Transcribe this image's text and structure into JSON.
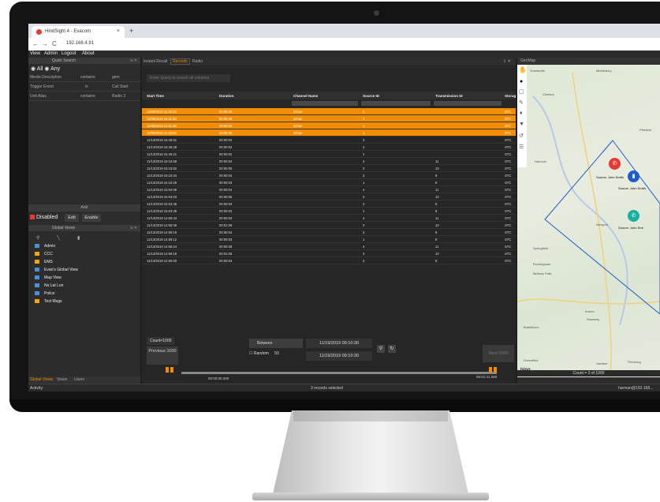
{
  "browser": {
    "tab_title": "HindSight 4 - Evacom",
    "tab_close": "×",
    "new_tab": "+",
    "nav_back": "←",
    "nav_forward": "→",
    "nav_reload": "C",
    "url": "192.168.4.91"
  },
  "menu": [
    "View",
    "Admin",
    "Logout",
    "About"
  ],
  "quick_search": {
    "title": "Quick Search",
    "radio_all": "All",
    "radio_any": "Any",
    "filters": [
      {
        "field": "Media Description",
        "op": "contains",
        "value": "gem"
      },
      {
        "field": "Trigger Event",
        "op": "is",
        "value": "Call Start"
      },
      {
        "field": "Unit Alias",
        "op": "contains",
        "value": "Radio 2"
      }
    ],
    "add_label": "Add",
    "disabled_label": "Disabled",
    "edit_label": "Edit",
    "enable_label": "Enable"
  },
  "global_views": {
    "title": "Global Views",
    "items": [
      {
        "label": "Admin",
        "color": "#4a90d9"
      },
      {
        "label": "CCC",
        "color": "#f2a900"
      },
      {
        "label": "EMS",
        "color": "#f2a900"
      },
      {
        "label": "Evan's Global View",
        "color": "#4a90d9"
      },
      {
        "label": "Map View",
        "color": "#4a90d9"
      },
      {
        "label": "No Lat Lon",
        "color": "#4a90d9"
      },
      {
        "label": "Police",
        "color": "#4a90d9"
      },
      {
        "label": "Text Msgs",
        "color": "#f2a900"
      }
    ],
    "bottom_tabs": [
      "Global Views",
      "Views",
      "Users"
    ]
  },
  "center": {
    "tabs": [
      "Instant Recall",
      "Records",
      "Radio"
    ],
    "query_placeholder": "Enter Query to search all columns",
    "columns": [
      "Start Time",
      "Duration",
      "Channel Name",
      "Source ID",
      "Transmission ID",
      "Storag"
    ],
    "rows": [
      {
        "start": "11/05/2019 11:42:24",
        "dur": "00:00:48",
        "chan": "4chan",
        "src": "2",
        "tx": "",
        "sto": "STC",
        "sel": true
      },
      {
        "start": "11/05/2019 11:41:30",
        "dur": "00:00:48",
        "chan": "4chan",
        "src": "1",
        "tx": "",
        "sto": "STC",
        "sel": true
      },
      {
        "start": "11/05/2019 11:41:30",
        "dur": "00:00:48",
        "chan": "4chan",
        "src": "1",
        "tx": "",
        "sto": "STC",
        "sel": true
      },
      {
        "start": "11/05/2019 11:43:04",
        "dur": "00:00:48",
        "chan": "4chan",
        "src": "1",
        "tx": "",
        "sto": "STC",
        "sel": true
      },
      {
        "start": "11/13/2019 15:45:51",
        "dur": "00:00:02",
        "chan": "",
        "src": "3",
        "tx": "",
        "sto": "STC",
        "sel": false
      },
      {
        "start": "11/13/2019 15:45:28",
        "dur": "00:00:02",
        "chan": "",
        "src": "2",
        "tx": "",
        "sto": "STC",
        "sel": false
      },
      {
        "start": "11/13/2019 15:45:21",
        "dur": "00:00:02",
        "chan": "",
        "src": "1",
        "tx": "",
        "sto": "STC",
        "sel": false
      },
      {
        "start": "11/13/2019 15:15:58",
        "dur": "00:00:04",
        "chan": "",
        "src": "4",
        "tx": "11",
        "sto": "STC",
        "sel": false
      },
      {
        "start": "11/13/2019 15:15:52",
        "dur": "00:00:05",
        "chan": "",
        "src": "3",
        "tx": "10",
        "sto": "STC",
        "sel": false
      },
      {
        "start": "11/13/2019 15:15:34",
        "dur": "00:00:04",
        "chan": "",
        "src": "2",
        "tx": "9",
        "sto": "STC",
        "sel": false
      },
      {
        "start": "11/13/2019 15:15:28",
        "dur": "00:00:03",
        "chan": "",
        "src": "1",
        "tx": "8",
        "sto": "STC",
        "sel": false
      },
      {
        "start": "11/13/2019 15:04:09",
        "dur": "00:00:04",
        "chan": "",
        "src": "4",
        "tx": "11",
        "sto": "STC",
        "sel": false
      },
      {
        "start": "11/13/2019 15:04:03",
        "dur": "00:00:05",
        "chan": "",
        "src": "3",
        "tx": "10",
        "sto": "STC",
        "sel": false
      },
      {
        "start": "11/13/2019 15:03:45",
        "dur": "00:00:04",
        "chan": "",
        "src": "2",
        "tx": "9",
        "sto": "STC",
        "sel": false
      },
      {
        "start": "11/13/2019 15:03:39",
        "dur": "00:00:03",
        "chan": "",
        "src": "1",
        "tx": "8",
        "sto": "STC",
        "sel": false
      },
      {
        "start": "11/13/2019 14:59:43",
        "dur": "00:00:03",
        "chan": "",
        "src": "4",
        "tx": "11",
        "sto": "STC",
        "sel": false
      },
      {
        "start": "11/13/2019 14:59:36",
        "dur": "00:01:09",
        "chan": "",
        "src": "3",
        "tx": "10",
        "sto": "STC",
        "sel": false
      },
      {
        "start": "11/13/2019 14:59:18",
        "dur": "00:00:04",
        "chan": "",
        "src": "2",
        "tx": "9",
        "sto": "STC",
        "sel": false
      },
      {
        "start": "11/13/2019 14:59:12",
        "dur": "00:00:03",
        "chan": "",
        "src": "1",
        "tx": "8",
        "sto": "STC",
        "sel": false
      },
      {
        "start": "11/13/2019 14:56:24",
        "dur": "00:00:38",
        "chan": "",
        "src": "4",
        "tx": "11",
        "sto": "STC",
        "sel": false
      },
      {
        "start": "11/13/2019 14:56:18",
        "dur": "00:01:05",
        "chan": "",
        "src": "3",
        "tx": "10",
        "sto": "STC",
        "sel": false
      },
      {
        "start": "11/13/2019 14:56:00",
        "dur": "00:00:04",
        "chan": "",
        "src": "2",
        "tx": "9",
        "sto": "STC",
        "sel": false
      }
    ],
    "count": "Count=1000",
    "prev": "Previous 1000",
    "next": "Next 1000",
    "between": "Between",
    "date_from": "11/19/2019 09:10:30",
    "date_to": "11/19/2019 09:10:30",
    "random": "Random",
    "random_n": "50",
    "time_start": "00:00:00.000",
    "time_end": "00:01:41.580",
    "speed": "1x"
  },
  "map": {
    "title": "GeoMap",
    "labels": [
      "Grantsville",
      "Chelsea",
      "Hanover",
      "Middlebury",
      "Rockingham",
      "Bellows Falls",
      "Springfield",
      "Keene",
      "Swanzey",
      "Brattleboro",
      "Greenfield",
      "Gardner",
      "Fitchburg",
      "Pittsfield",
      "Newport"
    ],
    "source_labels": [
      "Source: John Smith",
      "Source: John Smith",
      "Source: John Smi"
    ],
    "count": "Count = 3 of 1000",
    "bing": "bing"
  },
  "status": {
    "activity": "Activity:",
    "selected": "3 records selected",
    "user": "harman@192.168..."
  },
  "colors": {
    "accent": "#f28c00",
    "record_selected": "#f28c00",
    "marker_red": "#e53935",
    "marker_blue": "#1e5cc8",
    "marker_teal": "#17b0a0"
  }
}
